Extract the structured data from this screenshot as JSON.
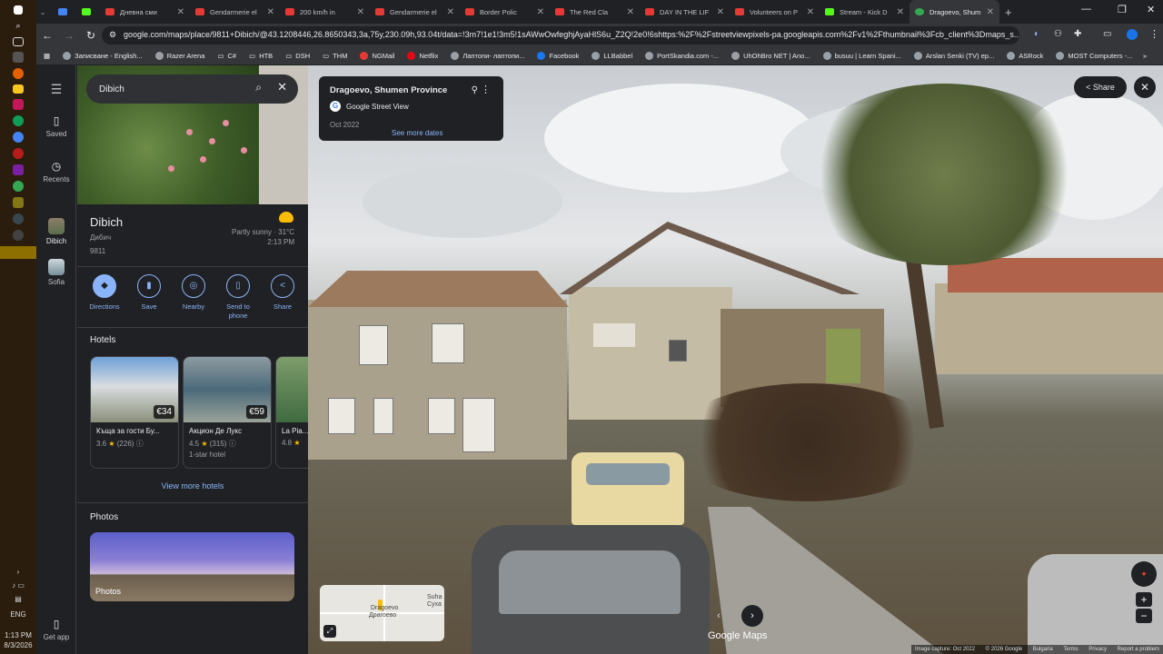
{
  "taskbar": {
    "time": "1:13 PM",
    "date": "8/3/2026",
    "language": "ENG"
  },
  "tabs": [
    {
      "label": "Дневна сми"
    },
    {
      "label": "Gendarmerie el"
    },
    {
      "label": "200 km/h in"
    },
    {
      "label": "Gendarmerie el"
    },
    {
      "label": "Border Polic"
    },
    {
      "label": "The Red Cla"
    },
    {
      "label": "DAY IN THE LIF"
    },
    {
      "label": "Volunteers on P"
    },
    {
      "label": "Stream - Kick D"
    },
    {
      "label": "Dragoevo, Shum"
    }
  ],
  "address_bar": {
    "url": "google.com/maps/place/9811+Dibich/@43.1208446,26.8650343,3a,75y,230.09h,93.04t/data=!3m7!1e1!3m5!1sAWwOwfeghjAyaHlS6u_Z2Q!2e0!6shttps:%2F%2Fstreetviewpixels-pa.googleapis.com%2Fv1%2Fthumbnail%3Fcb_client%3Dmaps_s..."
  },
  "bookmarks": [
    {
      "label": "Записване - English..."
    },
    {
      "label": "Razer Arena"
    },
    {
      "label": "C#"
    },
    {
      "label": "НТВ"
    },
    {
      "label": "DSH"
    },
    {
      "label": "THM"
    },
    {
      "label": "NGMail"
    },
    {
      "label": "Netflix"
    },
    {
      "label": "Лаптопи- лаптопи..."
    },
    {
      "label": "Facebook"
    },
    {
      "label": "LLBabbel"
    },
    {
      "label": "PortSkandia.com -..."
    },
    {
      "label": "UhOhBro NET | Ano..."
    },
    {
      "label": "busuu | Learn Spani..."
    },
    {
      "label": "Arslan Senki (TV) ep..."
    },
    {
      "label": "ASRock"
    },
    {
      "label": "MOST Computers -..."
    }
  ],
  "rail": {
    "saved": "Saved",
    "recents": "Recents",
    "recent1": "Dibich",
    "recent2": "Sofia",
    "get_app": "Get app"
  },
  "search": {
    "value": "Dibich"
  },
  "place": {
    "title": "Dibich",
    "alt_name": "Дибич",
    "code": "9811",
    "weather": "Partly sunny · 31°C",
    "time": "2:13 PM"
  },
  "actions": [
    {
      "label": "Directions",
      "icon": "◆"
    },
    {
      "label": "Save",
      "icon": "▮"
    },
    {
      "label": "Nearby",
      "icon": "◎"
    },
    {
      "label": "Send to phone",
      "icon": "▯"
    },
    {
      "label": "Share",
      "icon": "<"
    }
  ],
  "hotels": {
    "heading": "Hotels",
    "items": [
      {
        "name": "Къща за гости Бу...",
        "price": "€34",
        "rating": "3.6",
        "reviews": "(226)",
        "type": ""
      },
      {
        "name": "Акцион Де Лукс",
        "price": "€59",
        "rating": "4.5",
        "reviews": "(315)",
        "type": "1-star hotel"
      },
      {
        "name": "La Pia...",
        "price": "",
        "rating": "4.8",
        "reviews": "",
        "type": ""
      }
    ],
    "more": "View more hotels"
  },
  "photos": {
    "heading": "Photos",
    "label": "Photos"
  },
  "streetview": {
    "title": "Dragoevo, Shumen Province",
    "source": "Google Street View",
    "date": "Oct 2022",
    "more_dates": "See more dates",
    "share": "Share",
    "brand": "Google Maps",
    "minimap_labels": [
      "Dragoevo",
      "Драгоево",
      "Suha",
      "Суха"
    ],
    "footer": [
      "Image capture: Oct 2022",
      "© 2026 Google",
      "Bulgaria",
      "Terms",
      "Privacy",
      "Report a problem"
    ]
  }
}
